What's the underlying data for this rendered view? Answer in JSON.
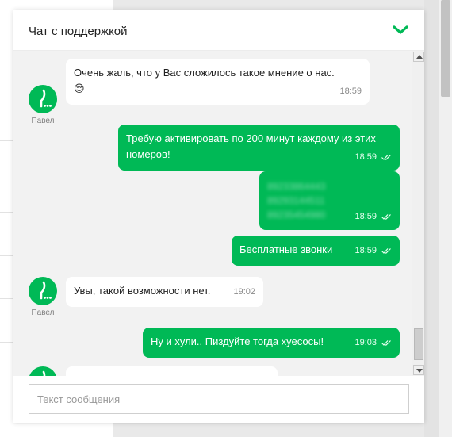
{
  "chat": {
    "title": "Чат с поддержкой",
    "collapse_icon": "chevron-down-icon",
    "accent_color": "#00b956",
    "input_placeholder": "Текст сообщения"
  },
  "messages": [
    {
      "from": "agent",
      "author": "Павел",
      "text": "Очень жаль, что у Вас сложилось такое мнение о нас.",
      "emoji": "😌",
      "time": "18:59"
    },
    {
      "from": "user",
      "text": "Требую активировать по 200 минут каждому из этих номеров!",
      "time": "18:59",
      "status_icon": "double-check-icon"
    },
    {
      "from": "user",
      "blurred": true,
      "lines": [
        "89233864443",
        "89293144511",
        "89235454980"
      ],
      "time": "18:59",
      "status_icon": "double-check-icon"
    },
    {
      "from": "user",
      "text": "Бесплатные звонки",
      "time": "18:59",
      "status_icon": "double-check-icon"
    },
    {
      "from": "agent",
      "author": "Павел",
      "text": "Увы, такой возможности нет.",
      "time": "19:02"
    },
    {
      "from": "user",
      "text": "Ну и хули.. Пиздуйте тогда хуесосы!",
      "time": "19:03",
      "status_icon": "double-check-icon"
    }
  ]
}
